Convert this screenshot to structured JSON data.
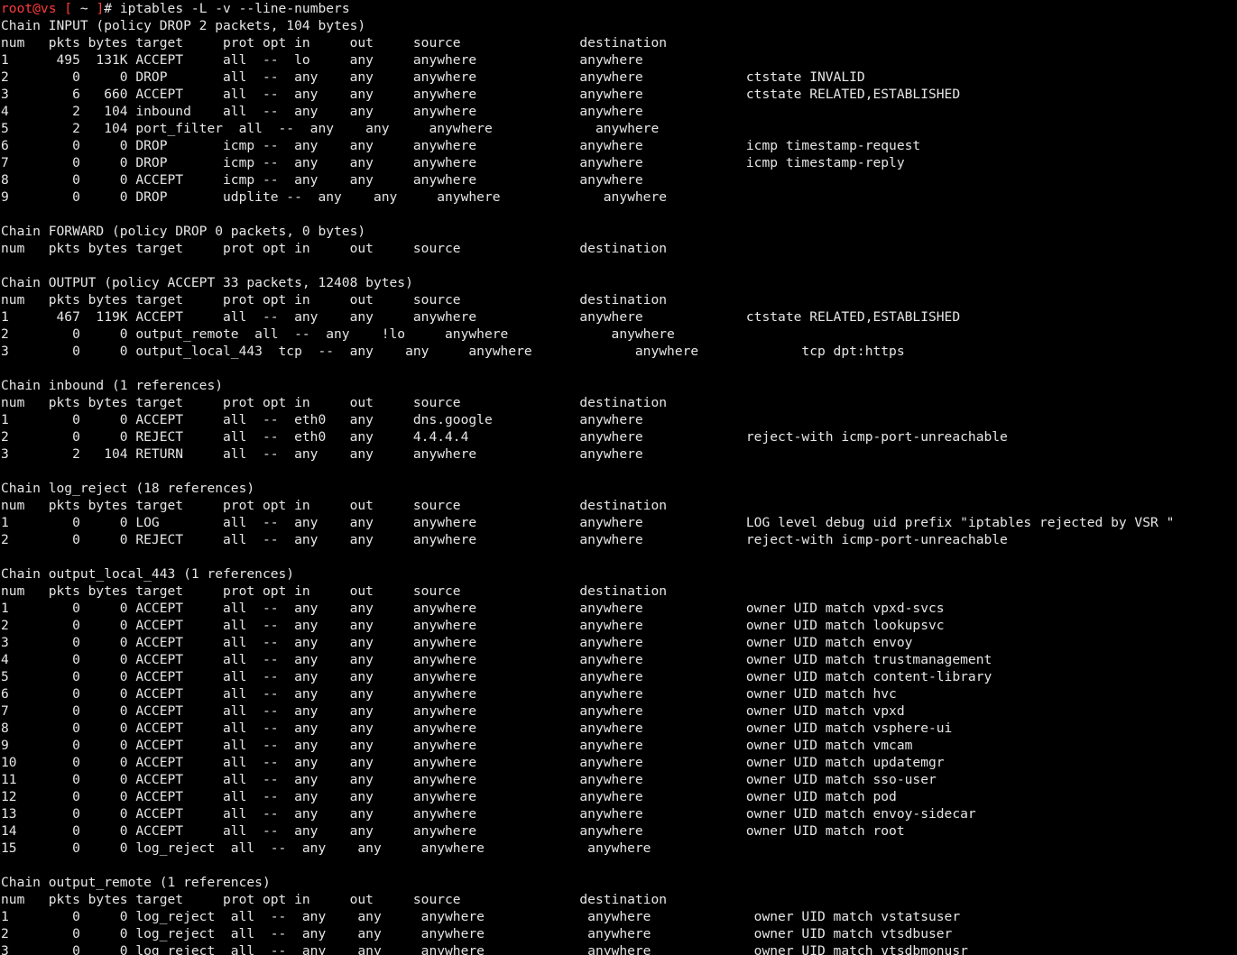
{
  "terminal": {
    "prompt": {
      "user_host": "root@vs",
      "open_bracket": " [ ",
      "path": "~",
      "close_bracket": " ]",
      "symbol": "# ",
      "command": "iptables -L -v --line-numbers"
    },
    "lines": [
      "Chain INPUT (policy DROP 2 packets, 104 bytes)",
      "num   pkts bytes target     prot opt in     out     source               destination",
      "1      495  131K ACCEPT     all  --  lo     any     anywhere             anywhere",
      "2        0     0 DROP       all  --  any    any     anywhere             anywhere             ctstate INVALID",
      "3        6   660 ACCEPT     all  --  any    any     anywhere             anywhere             ctstate RELATED,ESTABLISHED",
      "4        2   104 inbound    all  --  any    any     anywhere             anywhere",
      "5        2   104 port_filter  all  --  any    any     anywhere             anywhere",
      "6        0     0 DROP       icmp --  any    any     anywhere             anywhere             icmp timestamp-request",
      "7        0     0 DROP       icmp --  any    any     anywhere             anywhere             icmp timestamp-reply",
      "8        0     0 ACCEPT     icmp --  any    any     anywhere             anywhere",
      "9        0     0 DROP       udplite --  any    any     anywhere             anywhere",
      "",
      "Chain FORWARD (policy DROP 0 packets, 0 bytes)",
      "num   pkts bytes target     prot opt in     out     source               destination",
      "",
      "Chain OUTPUT (policy ACCEPT 33 packets, 12408 bytes)",
      "num   pkts bytes target     prot opt in     out     source               destination",
      "1      467  119K ACCEPT     all  --  any    any     anywhere             anywhere             ctstate RELATED,ESTABLISHED",
      "2        0     0 output_remote  all  --  any    !lo     anywhere             anywhere",
      "3        0     0 output_local_443  tcp  --  any    any     anywhere             anywhere             tcp dpt:https",
      "",
      "Chain inbound (1 references)",
      "num   pkts bytes target     prot opt in     out     source               destination",
      "1        0     0 ACCEPT     all  --  eth0   any     dns.google           anywhere",
      "2        0     0 REJECT     all  --  eth0   any     4.4.4.4              anywhere             reject-with icmp-port-unreachable",
      "3        2   104 RETURN     all  --  any    any     anywhere             anywhere",
      "",
      "Chain log_reject (18 references)",
      "num   pkts bytes target     prot opt in     out     source               destination",
      "1        0     0 LOG        all  --  any    any     anywhere             anywhere             LOG level debug uid prefix \"iptables rejected by VSR \"",
      "2        0     0 REJECT     all  --  any    any     anywhere             anywhere             reject-with icmp-port-unreachable",
      "",
      "Chain output_local_443 (1 references)",
      "num   pkts bytes target     prot opt in     out     source               destination",
      "1        0     0 ACCEPT     all  --  any    any     anywhere             anywhere             owner UID match vpxd-svcs",
      "2        0     0 ACCEPT     all  --  any    any     anywhere             anywhere             owner UID match lookupsvc",
      "3        0     0 ACCEPT     all  --  any    any     anywhere             anywhere             owner UID match envoy",
      "4        0     0 ACCEPT     all  --  any    any     anywhere             anywhere             owner UID match trustmanagement",
      "5        0     0 ACCEPT     all  --  any    any     anywhere             anywhere             owner UID match content-library",
      "6        0     0 ACCEPT     all  --  any    any     anywhere             anywhere             owner UID match hvc",
      "7        0     0 ACCEPT     all  --  any    any     anywhere             anywhere             owner UID match vpxd",
      "8        0     0 ACCEPT     all  --  any    any     anywhere             anywhere             owner UID match vsphere-ui",
      "9        0     0 ACCEPT     all  --  any    any     anywhere             anywhere             owner UID match vmcam",
      "10       0     0 ACCEPT     all  --  any    any     anywhere             anywhere             owner UID match updatemgr",
      "11       0     0 ACCEPT     all  --  any    any     anywhere             anywhere             owner UID match sso-user",
      "12       0     0 ACCEPT     all  --  any    any     anywhere             anywhere             owner UID match pod",
      "13       0     0 ACCEPT     all  --  any    any     anywhere             anywhere             owner UID match envoy-sidecar",
      "14       0     0 ACCEPT     all  --  any    any     anywhere             anywhere             owner UID match root",
      "15       0     0 log_reject  all  --  any    any     anywhere             anywhere",
      "",
      "Chain output_remote (1 references)",
      "num   pkts bytes target     prot opt in     out     source               destination",
      "1        0     0 log_reject  all  --  any    any     anywhere             anywhere             owner UID match vstatsuser",
      "2        0     0 log_reject  all  --  any    any     anywhere             anywhere             owner UID match vtsdbuser",
      "3        0     0 log_reject  all  --  any    any     anywhere             anywhere             owner UID match vtsdbmonusr"
    ]
  }
}
